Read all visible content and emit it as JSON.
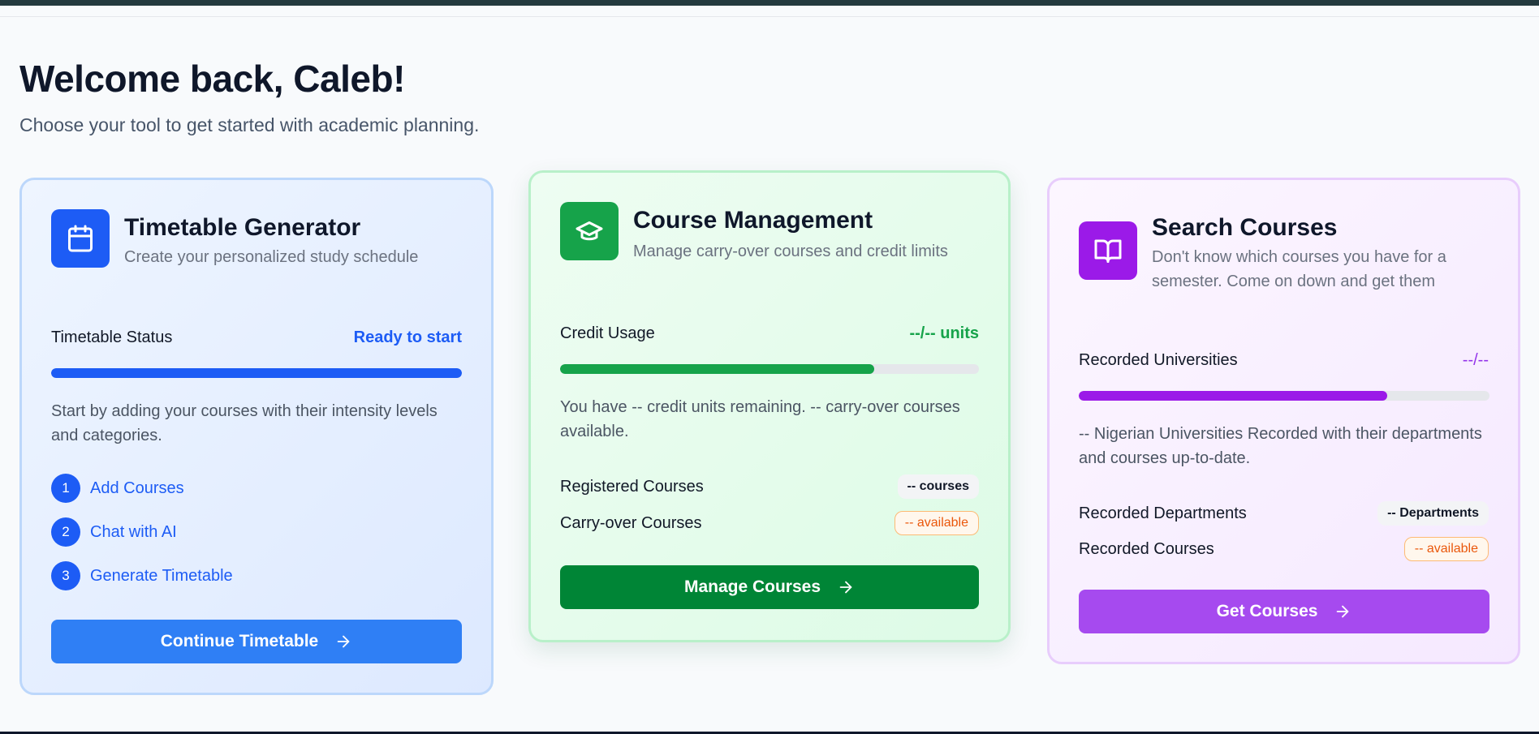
{
  "header": {
    "welcome": "Welcome back, Caleb!",
    "subtitle": "Choose your tool to get started with academic planning."
  },
  "cards": {
    "timetable": {
      "title": "Timetable Generator",
      "description": "Create your personalized study schedule",
      "status_label": "Timetable Status",
      "status_value": "Ready to start",
      "progress": 1.0,
      "paragraph": "Start by adding your courses with their intensity levels and categories.",
      "steps": [
        {
          "number": "1",
          "label": "Add Courses"
        },
        {
          "number": "2",
          "label": "Chat with AI"
        },
        {
          "number": "3",
          "label": "Generate Timetable"
        }
      ],
      "button": "Continue Timetable",
      "icon": "calendar-icon",
      "accent": "#1d5cf5"
    },
    "course": {
      "title": "Course Management",
      "description": "Manage carry-over courses and credit limits",
      "usage_label": "Credit Usage",
      "usage_value": "--/-- units",
      "progress": 0.75,
      "paragraph": "You have -- credit units remaining. -- carry-over courses available.",
      "registered_label": "Registered Courses",
      "registered_badge": "-- courses",
      "carry_label": "Carry-over Courses",
      "carry_badge": "-- available",
      "button": "Manage Courses",
      "icon": "graduation-cap-icon",
      "accent": "#16a34a"
    },
    "search": {
      "title": "Search Courses",
      "description": "Don't know which courses you have for a semester. Come on down and get them",
      "recorded_label": "Recorded Universities",
      "recorded_value": "--/--",
      "progress": 0.75,
      "paragraph": "-- Nigerian Universities Recorded with their departments and courses up-to-date.",
      "departments_label": "Recorded Departments",
      "departments_badge": "-- Departments",
      "courses_label": "Recorded Courses",
      "courses_badge": "-- available",
      "button": "Get Courses",
      "icon": "book-open-icon",
      "accent": "#9333ea"
    }
  }
}
